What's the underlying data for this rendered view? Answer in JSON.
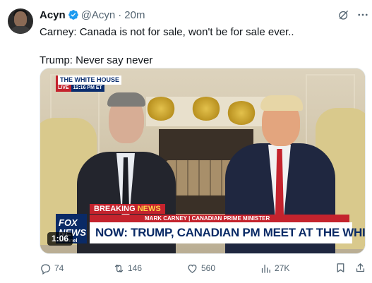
{
  "author": {
    "name": "Acyn",
    "handle": "@Acyn",
    "separator": "·",
    "time": "20m"
  },
  "tweet": {
    "line1": "Carney: Canada is not for sale, won't be for sale ever..",
    "line2": "Trump: Never say never"
  },
  "media": {
    "duration": "1:06",
    "overlay": {
      "wh_title": "THE WHITE HOUSE",
      "wh_live": "LIVE",
      "wh_time": "12:16 PM ET",
      "breaking_1": "BREAKING",
      "breaking_2": "NEWS",
      "subline_name": "MARK CARNEY",
      "subline_sep": "|",
      "subline_title": "CANADIAN PRIME MINISTER",
      "headline": "NOW: TRUMP, CANADIAN PM MEET AT THE WHITE HOUSE",
      "fox_logo_1": "FOX",
      "fox_logo_2": "NEWS",
      "fox_logo_3": "channel"
    }
  },
  "actions": {
    "replies": "74",
    "reposts": "146",
    "likes": "560",
    "views": "27K"
  },
  "icons": {
    "verified": "verified-badge-icon",
    "grok": "grok-icon",
    "more": "more-icon",
    "reply": "reply-icon",
    "repost": "repost-icon",
    "like": "heart-icon",
    "views": "views-icon",
    "bookmark": "bookmark-icon",
    "share": "share-icon"
  },
  "colors": {
    "verified": "#1d9bf0",
    "text_secondary": "#536471",
    "fox_red": "#c4232d",
    "fox_blue": "#0a2a66"
  }
}
